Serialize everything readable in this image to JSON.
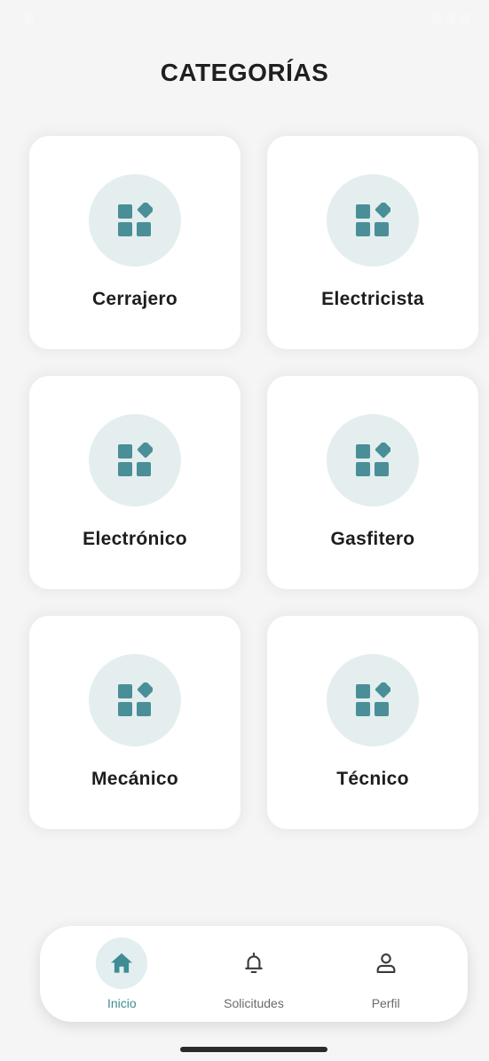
{
  "status_bar": {
    "time": ""
  },
  "page": {
    "title": "CATEGORÍAS"
  },
  "categories": [
    {
      "label": "Cerrajero",
      "icon": "category-grid-icon"
    },
    {
      "label": "Electricista",
      "icon": "category-grid-icon"
    },
    {
      "label": "Electrónico",
      "icon": "category-grid-icon"
    },
    {
      "label": "Gasfitero",
      "icon": "category-grid-icon"
    },
    {
      "label": "Mecánico",
      "icon": "category-grid-icon"
    },
    {
      "label": "Técnico",
      "icon": "category-grid-icon"
    }
  ],
  "nav": {
    "items": [
      {
        "label": "Inicio",
        "icon": "home-icon",
        "active": true
      },
      {
        "label": "Solicitudes",
        "icon": "bell-icon",
        "active": false
      },
      {
        "label": "Perfil",
        "icon": "user-icon",
        "active": false
      }
    ]
  },
  "colors": {
    "accent": "#4a8f97",
    "icon_circle_bg": "#e5eeef",
    "background": "#f5f5f5",
    "card_bg": "#ffffff",
    "text": "#1d1d1d"
  }
}
